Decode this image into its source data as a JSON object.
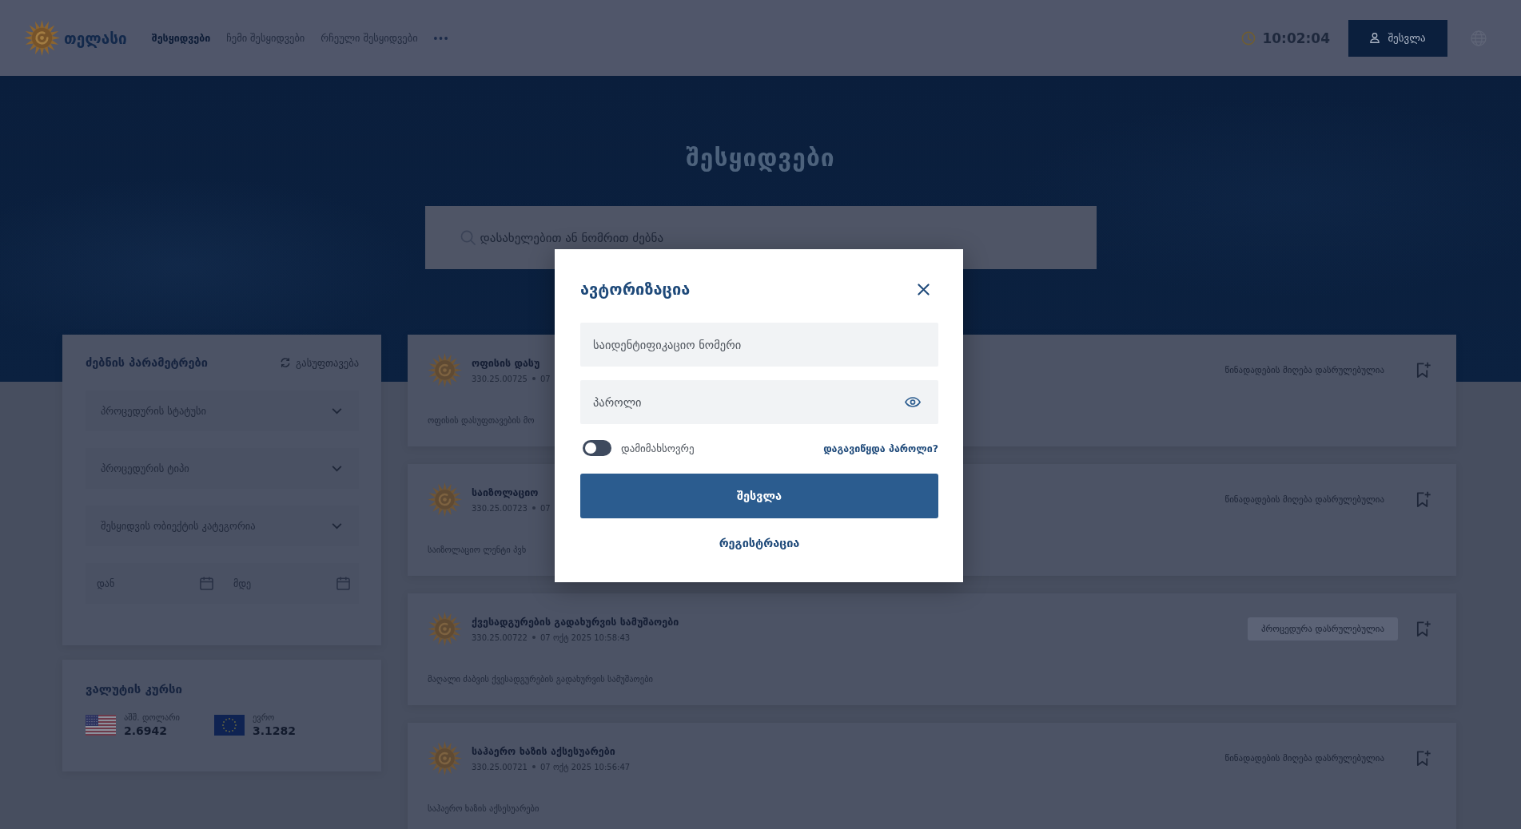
{
  "header": {
    "logo_text": "თელასი",
    "nav": [
      {
        "label": "შესყიდვები",
        "selected": true
      },
      {
        "label": "ჩემი შესყიდვები",
        "selected": false
      },
      {
        "label": "რჩეული შესყიდვები",
        "selected": false
      }
    ],
    "time": "10:02:04",
    "login_button": "შესვლა"
  },
  "hero": {
    "title": "შესყიდვები",
    "search": {
      "placeholder": "დასახელებით ან ნომრით ძებნა"
    }
  },
  "filters": {
    "title": "ძებნის პარამეტრები",
    "reset": "გასუფთავება",
    "dropdowns": [
      {
        "placeholder": "პროცედურის სტატუსი"
      },
      {
        "placeholder": "პროცედურის ტიპი"
      },
      {
        "placeholder": "შესყიდვის ობიექტის კატეგორია"
      }
    ],
    "date_from": {
      "placeholder": "დან"
    },
    "date_to": {
      "placeholder": "მდე"
    }
  },
  "currency": {
    "title": "ვალუტის კურსი",
    "rates": [
      {
        "kind": "usd",
        "name": "აშშ. დოლარი",
        "rate": "2.6942"
      },
      {
        "kind": "eur",
        "name": "ევრო",
        "rate": "3.1282"
      }
    ]
  },
  "tenders": [
    {
      "title": "ოფისის დასუ",
      "number": "330.25.00725",
      "date": "07",
      "description": "ოფისის დასუფთავების მო",
      "status": {
        "kind": "text",
        "label": "წინადადების მიღება დასრულებულია"
      }
    },
    {
      "title": "საიზოლაციო",
      "number": "330.25.00723",
      "date": "07",
      "description": "საიზოლაციო ლენტი პვხ",
      "status": {
        "kind": "text",
        "label": "წინადადების მიღება დასრულებულია"
      }
    },
    {
      "title": "ქვესადგურების გადახურვის სამუშაოები",
      "number": "330.25.00722",
      "date": "07 ოქტ 2025 10:58:43",
      "description": "მაღალი ძაბვის ქვესადგურების გადახურვის სამუშაოები",
      "status": {
        "kind": "badge",
        "label": "პროცედურა დასრულებულია"
      }
    },
    {
      "title": "საჰაერო ხაზის აქსესუარები",
      "number": "330.25.00721",
      "date": "07 ოქტ 2025 10:56:47",
      "description": "საჰაერო ხაზის აქსესუარები",
      "status": {
        "kind": "text",
        "label": "წინადადების მიღება დასრულებულია"
      }
    }
  ],
  "login_dialog": {
    "title": "ავტორიზაცია",
    "id_field": {
      "placeholder": "საიდენტიფიკაციო ნომერი"
    },
    "password_field": {
      "placeholder": "პაროლი"
    },
    "remember": {
      "label": "დამიმახსოვრე",
      "on": false
    },
    "forgot_link": "დაგავიწყდა პაროლი?",
    "submit": "შესვლა",
    "register_link": "რეგისტრაცია"
  }
}
